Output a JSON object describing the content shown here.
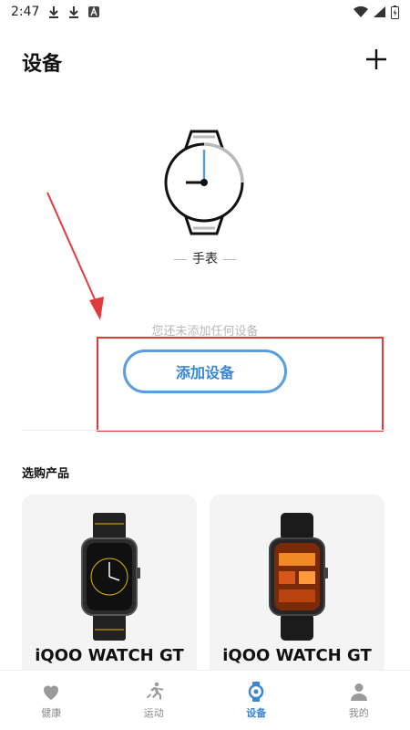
{
  "status_bar": {
    "time": "2:47",
    "icons": [
      "download-icon",
      "download-icon",
      "app-a-icon",
      "wifi-icon",
      "signal-icon",
      "battery-charging-icon"
    ]
  },
  "header": {
    "title": "设备",
    "add_icon": "plus-icon"
  },
  "device": {
    "type_label": "手表",
    "empty_note": "您还未添加任何设备",
    "add_button_label": "添加设备"
  },
  "shop": {
    "title": "选购产品",
    "products": [
      {
        "name": "iQOO WATCH GT"
      },
      {
        "name": "iQOO WATCH GT"
      }
    ]
  },
  "bottom_nav": {
    "items": [
      {
        "label": "健康",
        "icon": "heart-icon",
        "active": false
      },
      {
        "label": "运动",
        "icon": "running-icon",
        "active": false
      },
      {
        "label": "设备",
        "icon": "watch-icon",
        "active": true
      },
      {
        "label": "我的",
        "icon": "person-icon",
        "active": false
      }
    ]
  },
  "colors": {
    "accent": "#3a86d4",
    "annotation": "#e23a3a",
    "muted_text": "#b8b8b8",
    "card_bg": "#f4f4f4"
  }
}
